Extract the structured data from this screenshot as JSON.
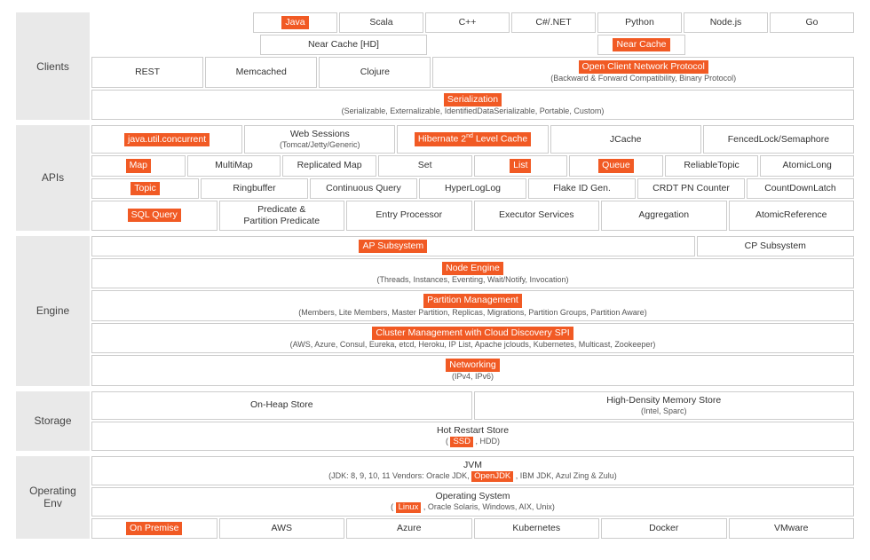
{
  "clients": {
    "label": "Clients",
    "langs": [
      "Java",
      "Scala",
      "C++",
      "C#/.NET",
      "Python",
      "Node.js",
      "Go"
    ],
    "nearCacheHD": "Near Cache [HD]",
    "nearCache": "Near Cache",
    "rest": "REST",
    "memcached": "Memcached",
    "clojure": "Clojure",
    "openProtocol": "Open Client Network Protocol",
    "openProtocolSub": "(Backward & Forward Compatibility, Binary Protocol)",
    "serialization": "Serialization",
    "serializationSub": "(Serializable, Externalizable, IdentifiedDataSerializable, Portable, Custom)"
  },
  "apis": {
    "label": "APIs",
    "r1": {
      "juc": "java.util.concurrent",
      "web": "Web Sessions",
      "webSub": "(Tomcat/Jetty/Generic)",
      "hibernate_pre": "Hibernate 2",
      "hibernate_suf": " Level Cache",
      "jcache": "JCache",
      "fenced": "FencedLock/Semaphore"
    },
    "r2": [
      "Map",
      "MultiMap",
      "Replicated Map",
      "Set",
      "List",
      "Queue",
      "ReliableTopic",
      "AtomicLong"
    ],
    "r3": [
      "Topic",
      "Ringbuffer",
      "Continuous Query",
      "HyperLogLog",
      "Flake ID Gen.",
      "CRDT PN Counter",
      "CountDownLatch"
    ],
    "r4": [
      "SQL Query",
      "Predicate &\nPartition Predicate",
      "Entry Processor",
      "Executor Services",
      "Aggregation",
      "AtomicReference"
    ]
  },
  "engine": {
    "label": "Engine",
    "ap": "AP Subsystem",
    "cp": "CP Subsystem",
    "node": "Node Engine",
    "nodeSub": "(Threads, Instances, Eventing, Wait/Notify, Invocation)",
    "partition": "Partition Management",
    "partitionSub": "(Members, Lite Members, Master Partition, Replicas, Migrations, Partition Groups, Partition Aware)",
    "cluster": "Cluster Management with Cloud Discovery SPI",
    "clusterSub": "(AWS, Azure, Consul, Eureka, etcd, Heroku, IP List, Apache jclouds, Kubernetes, Multicast, Zookeeper)",
    "net": "Networking",
    "netSub": "(IPv4, IPv6)"
  },
  "storage": {
    "label": "Storage",
    "onheap": "On-Heap Store",
    "hd": "High-Density Memory Store",
    "hdSub": "(Intel, Sparc)",
    "restart": "Hot Restart Store",
    "restartPre": "( ",
    "restartSSD": "SSD",
    "restartPost": " , HDD)"
  },
  "env": {
    "label": "Operating Env",
    "jvm": "JVM",
    "jvmLine": "(JDK: 8, 9, 10, 11    Vendors: Oracle JDK, ",
    "openjdk": "OpenJDK",
    "jvmPost": " , IBM JDK, Azul Zing & Zulu)",
    "os": "Operating System",
    "osPre": "( ",
    "linux": "Linux",
    "osPost": " , Oracle Solaris, Windows, AIX, Unix)",
    "deploy": [
      "On Premise",
      "AWS",
      "Azure",
      "Kubernetes",
      "Docker",
      "VMware"
    ]
  }
}
